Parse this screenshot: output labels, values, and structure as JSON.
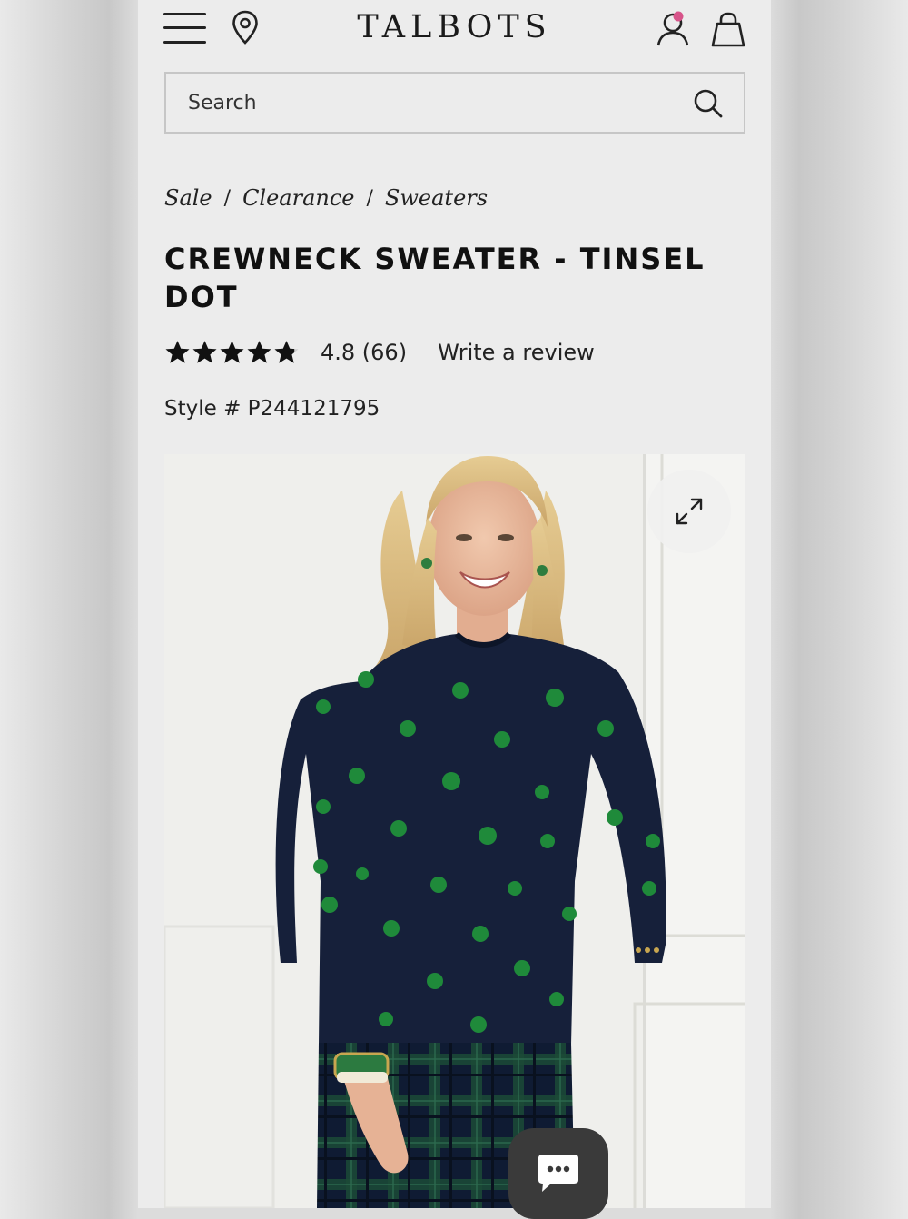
{
  "header": {
    "brand": "TALBOTS",
    "icons": [
      "menu-icon",
      "location-pin-icon",
      "account-icon",
      "shopping-bag-icon"
    ],
    "notification_dot_color": "#d7548a"
  },
  "search": {
    "placeholder": "Search"
  },
  "breadcrumb": {
    "items": [
      "Sale",
      "Clearance",
      "Sweaters"
    ],
    "separator": "/"
  },
  "product": {
    "title": "CREWNECK SWEATER - TINSEL DOT",
    "rating": 4.8,
    "rating_text": "4.8 (66)",
    "write_review_label": "Write a review",
    "style_number": "Style # P244121795"
  },
  "media": {
    "sweater_color": "#16203a",
    "dot_color": "#1f8a3a",
    "pants_pattern": "navy/green plaid"
  },
  "colors": {
    "page_bg": "#ececec",
    "text": "#111111",
    "border": "#c6c6c6",
    "chat_button": "#3a3a3a"
  }
}
